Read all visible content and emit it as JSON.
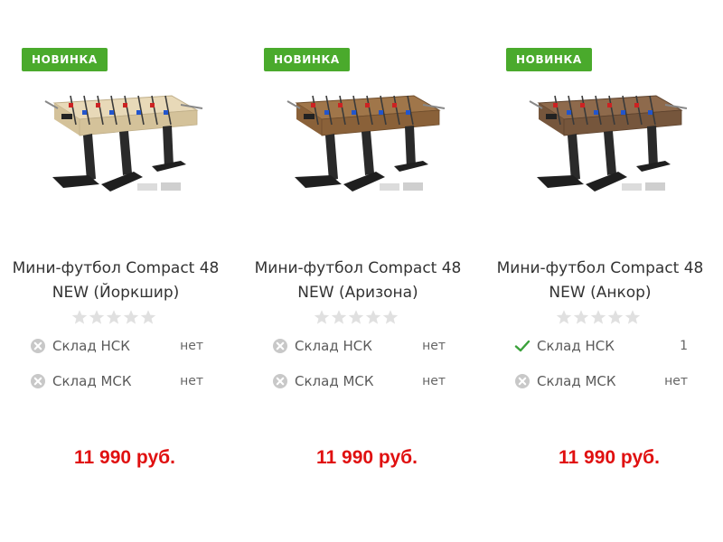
{
  "colors": {
    "badge_bg": "#4aaa2c",
    "price": "#e01010",
    "available_icon": "#3aa13a",
    "unavailable_icon": "#c8c8c8",
    "star_empty": "#e0e0e0"
  },
  "products": [
    {
      "badge": "НОВИНКА",
      "title": "Мини-футбол Compact 48 NEW (Йоркшир)",
      "rating": 0,
      "rating_max": 5,
      "stock": [
        {
          "label": "Склад НСК",
          "value": "нет",
          "available": false,
          "icon": "cross-circle-icon"
        },
        {
          "label": "Склад МСК",
          "value": "нет",
          "available": false,
          "icon": "cross-circle-icon"
        }
      ],
      "price": "11 990 руб.",
      "image_icon": "foosball-table-image"
    },
    {
      "badge": "НОВИНКА",
      "title": "Мини-футбол Compact 48 NEW (Аризона)",
      "rating": 0,
      "rating_max": 5,
      "stock": [
        {
          "label": "Склад НСК",
          "value": "нет",
          "available": false,
          "icon": "cross-circle-icon"
        },
        {
          "label": "Склад МСК",
          "value": "нет",
          "available": false,
          "icon": "cross-circle-icon"
        }
      ],
      "price": "11 990 руб.",
      "image_icon": "foosball-table-image"
    },
    {
      "badge": "НОВИНКА",
      "title": "Мини-футбол Compact 48 NEW (Анкор)",
      "rating": 0,
      "rating_max": 5,
      "stock": [
        {
          "label": "Склад НСК",
          "value": "1",
          "available": true,
          "icon": "check-icon"
        },
        {
          "label": "Склад МСК",
          "value": "нет",
          "available": false,
          "icon": "cross-circle-icon"
        }
      ],
      "price": "11 990 руб.",
      "image_icon": "foosball-table-image"
    }
  ]
}
